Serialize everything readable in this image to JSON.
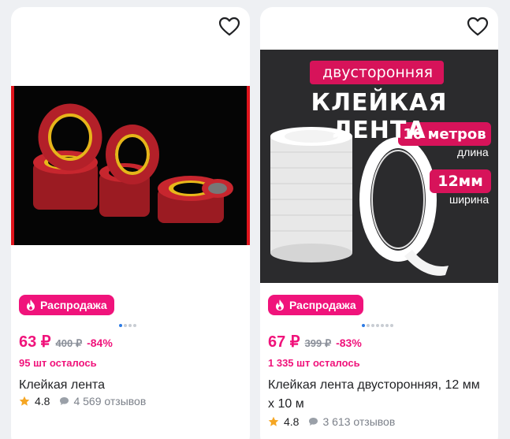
{
  "products": [
    {
      "badge_label": "Распродажа",
      "price": "63 ₽",
      "old_price": "400 ₽",
      "discount": "-84%",
      "stock": "95 шт осталось",
      "title": "Клейкая лента",
      "rating": "4.8",
      "reviews": "4 569 отзывов",
      "carousel_dots": 4,
      "carousel_active": 0
    },
    {
      "badge_label": "Распродажа",
      "price": "67 ₽",
      "old_price": "399 ₽",
      "discount": "-83%",
      "stock": "1 335 шт осталось",
      "title": "Клейкая лента двусторонняя, 12 мм х 10 м",
      "rating": "4.8",
      "reviews": "3 613 отзывов",
      "carousel_dots": 7,
      "carousel_active": 0,
      "image_text": {
        "tag": "двусторонняя",
        "headline": "КЛЕЙКАЯ ЛЕНТА",
        "length_value": "10 метров",
        "length_label": "длина",
        "width_value": "12мм",
        "width_label": "ширина"
      }
    }
  ],
  "colors": {
    "accent": "#f0137b",
    "star": "#f5a623",
    "dot_active": "#2c7be5"
  },
  "icons": [
    "heart-icon",
    "fire-icon",
    "star-icon",
    "comment-icon"
  ]
}
